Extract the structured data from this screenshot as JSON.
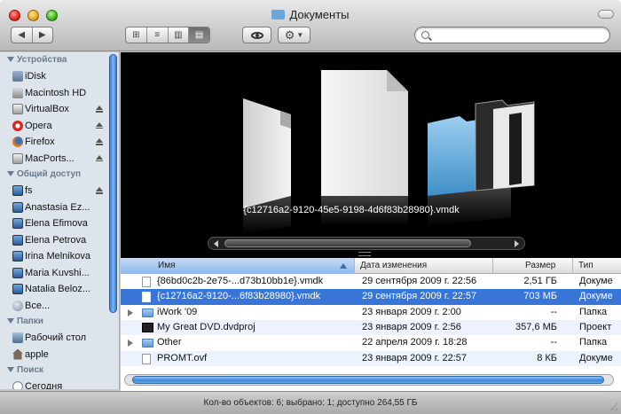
{
  "window": {
    "title": "Документы"
  },
  "toolbar": {
    "back_icon": "chevron-left-icon",
    "forward_icon": "chevron-right-icon",
    "views": [
      "icon-view",
      "list-view",
      "column-view",
      "coverflow-view"
    ],
    "active_view": "coverflow-view",
    "quicklook_icon": "eye-icon",
    "action_icon": "gear-icon",
    "search_value": "",
    "search_placeholder": ""
  },
  "sidebar": {
    "sections": [
      {
        "title": "Устройства",
        "items": [
          {
            "label": "iDisk",
            "icon": "idisk-icon",
            "eject": false
          },
          {
            "label": "Macintosh HD",
            "icon": "hard-drive-icon",
            "eject": false
          },
          {
            "label": "VirtualBox",
            "icon": "volume-icon",
            "eject": true
          },
          {
            "label": "Opera",
            "icon": "opera-icon",
            "eject": true
          },
          {
            "label": "Firefox",
            "icon": "firefox-icon",
            "eject": true
          },
          {
            "label": "MacPorts...",
            "icon": "volume-icon",
            "eject": true
          }
        ]
      },
      {
        "title": "Общий доступ",
        "items": [
          {
            "label": "fs",
            "icon": "monitor-icon",
            "eject": true
          },
          {
            "label": "Anastasia Ez...",
            "icon": "monitor-icon",
            "eject": false
          },
          {
            "label": "Elena Efimova",
            "icon": "monitor-icon",
            "eject": false
          },
          {
            "label": "Elena Petrova",
            "icon": "monitor-icon",
            "eject": false
          },
          {
            "label": "Irina Melnikova",
            "icon": "monitor-icon",
            "eject": false
          },
          {
            "label": "Maria Kuvshi...",
            "icon": "monitor-icon",
            "eject": false
          },
          {
            "label": "Natalia Beloz...",
            "icon": "monitor-icon",
            "eject": false
          },
          {
            "label": "Все...",
            "icon": "globe-icon",
            "eject": false
          }
        ]
      },
      {
        "title": "Папки",
        "items": [
          {
            "label": "Рабочий стол",
            "icon": "desktop-icon",
            "eject": false
          },
          {
            "label": "apple",
            "icon": "home-icon",
            "eject": false
          }
        ]
      },
      {
        "title": "Поиск",
        "items": [
          {
            "label": "Сегодня",
            "icon": "clock-icon",
            "eject": false
          }
        ]
      }
    ]
  },
  "coverflow": {
    "caption": "{c12716a2-9120-45e5-9198-4d6f83b28980}.vmdk"
  },
  "list": {
    "columns": {
      "name": "Имя",
      "date": "Дата изменения",
      "size": "Размер",
      "kind": "Тип"
    },
    "rows": [
      {
        "name": "{86bd0c2b-2e75-...d73b10bb1e}.vmdk",
        "date": "29 сентября 2009 г. 22:56",
        "size": "2,51 ГБ",
        "kind": "Докуме",
        "type": "file",
        "selected": false
      },
      {
        "name": "{c12716a2-9120-...6f83b28980}.vmdk",
        "date": "29 сентября 2009 г. 22:57",
        "size": "703 МБ",
        "kind": "Докуме",
        "type": "file",
        "selected": true
      },
      {
        "name": "iWork '09",
        "date": "23 января 2009 г. 2:00",
        "size": "--",
        "kind": "Папка",
        "type": "folder",
        "selected": false
      },
      {
        "name": "My Great DVD.dvdproj",
        "date": "23 января 2009 г. 2:56",
        "size": "357,6 МБ",
        "kind": "Проект",
        "type": "dvd",
        "selected": false
      },
      {
        "name": "Other",
        "date": "22 апреля 2009 г. 18:28",
        "size": "--",
        "kind": "Папка",
        "type": "folder",
        "selected": false
      },
      {
        "name": "PROMT.ovf",
        "date": "23 января 2009 г. 22:57",
        "size": "8 КБ",
        "kind": "Докуме",
        "type": "file",
        "selected": false
      }
    ]
  },
  "status": {
    "text": "Кол-во объектов: 6; выбрано: 1; доступно 264,55 ГБ"
  },
  "colors": {
    "selection": "#3875d7",
    "scroll_accent": "#3d86d9",
    "sidebar_bg": "#dde4ec"
  }
}
